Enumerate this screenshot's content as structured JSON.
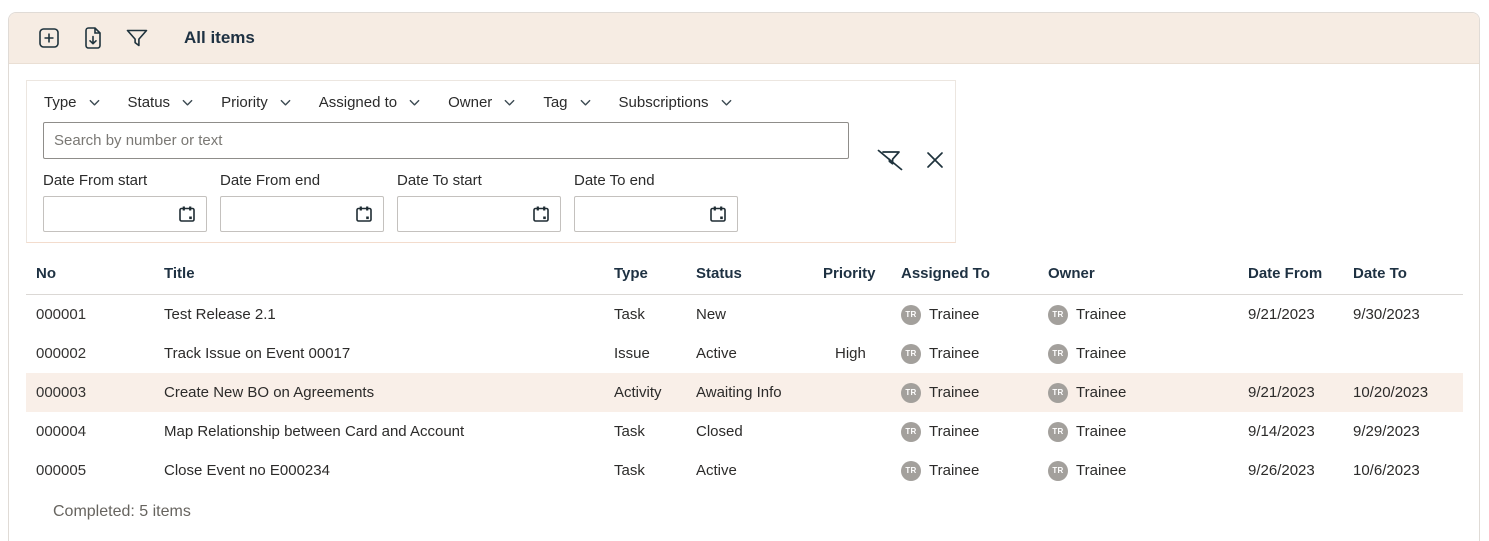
{
  "commandbar": {
    "title": "All items",
    "buttons": [
      {
        "name": "add",
        "icon": "plus-square-icon"
      },
      {
        "name": "export",
        "icon": "document-arrow-down-icon"
      },
      {
        "name": "filter",
        "icon": "filter-icon"
      }
    ]
  },
  "filters": {
    "dropdowns": [
      {
        "label": "Type"
      },
      {
        "label": "Status"
      },
      {
        "label": "Priority"
      },
      {
        "label": "Assigned to"
      },
      {
        "label": "Owner"
      },
      {
        "label": "Tag"
      },
      {
        "label": "Subscriptions"
      }
    ],
    "search": {
      "value": "",
      "placeholder": "Search by number or text"
    },
    "actions": [
      {
        "name": "clear-filters",
        "icon": "clear-filter-icon"
      },
      {
        "name": "close",
        "icon": "close-icon"
      }
    ],
    "date_fields": [
      {
        "label": "Date From start",
        "value": "",
        "icon": "calendar-icon"
      },
      {
        "label": "Date From end",
        "value": "",
        "icon": "calendar-icon"
      },
      {
        "label": "Date To start",
        "value": "",
        "icon": "calendar-icon"
      },
      {
        "label": "Date To end",
        "value": "",
        "icon": "calendar-icon"
      }
    ]
  },
  "table": {
    "columns": [
      "No",
      "Title",
      "Type",
      "Status",
      "Priority",
      "Assigned To",
      "Owner",
      "Date From",
      "Date To"
    ],
    "rows": [
      {
        "no": "000001",
        "title": "Test Release 2.1",
        "type": "Task",
        "status": "New",
        "priority": "",
        "assigned_to": "Trainee",
        "owner": "Trainee",
        "avatar_initials": "TR",
        "date_from": "9/21/2023",
        "date_to": "9/30/2023",
        "highlighted": false
      },
      {
        "no": "000002",
        "title": "Track Issue on Event 00017",
        "type": "Issue",
        "status": "Active",
        "priority": "High",
        "assigned_to": "Trainee",
        "owner": "Trainee",
        "avatar_initials": "TR",
        "date_from": "",
        "date_to": "",
        "highlighted": false
      },
      {
        "no": "000003",
        "title": "Create New BO on Agreements",
        "type": "Activity",
        "status": "Awaiting Info",
        "priority": "",
        "assigned_to": "Trainee",
        "owner": "Trainee",
        "avatar_initials": "TR",
        "date_from": "9/21/2023",
        "date_to": "10/20/2023",
        "highlighted": true
      },
      {
        "no": "000004",
        "title": "Map Relationship between Card and Account",
        "type": "Task",
        "status": "Closed",
        "priority": "",
        "assigned_to": "Trainee",
        "owner": "Trainee",
        "avatar_initials": "TR",
        "date_from": "9/14/2023",
        "date_to": "9/29/2023",
        "highlighted": false
      },
      {
        "no": "000005",
        "title": "Close Event no E000234",
        "type": "Task",
        "status": "Active",
        "priority": "",
        "assigned_to": "Trainee",
        "owner": "Trainee",
        "avatar_initials": "TR",
        "date_from": "9/26/2023",
        "date_to": "10/6/2023",
        "highlighted": false
      }
    ],
    "footer": "Completed: 5 items"
  },
  "colors": {
    "commandbar_bg": "#f6ece3",
    "row_highlight_bg": "#f9efe8",
    "avatar_bg": "#a3a09c",
    "header_text": "#1e3142",
    "body_text": "#2c2b2a",
    "muted_text": "#67645f"
  }
}
